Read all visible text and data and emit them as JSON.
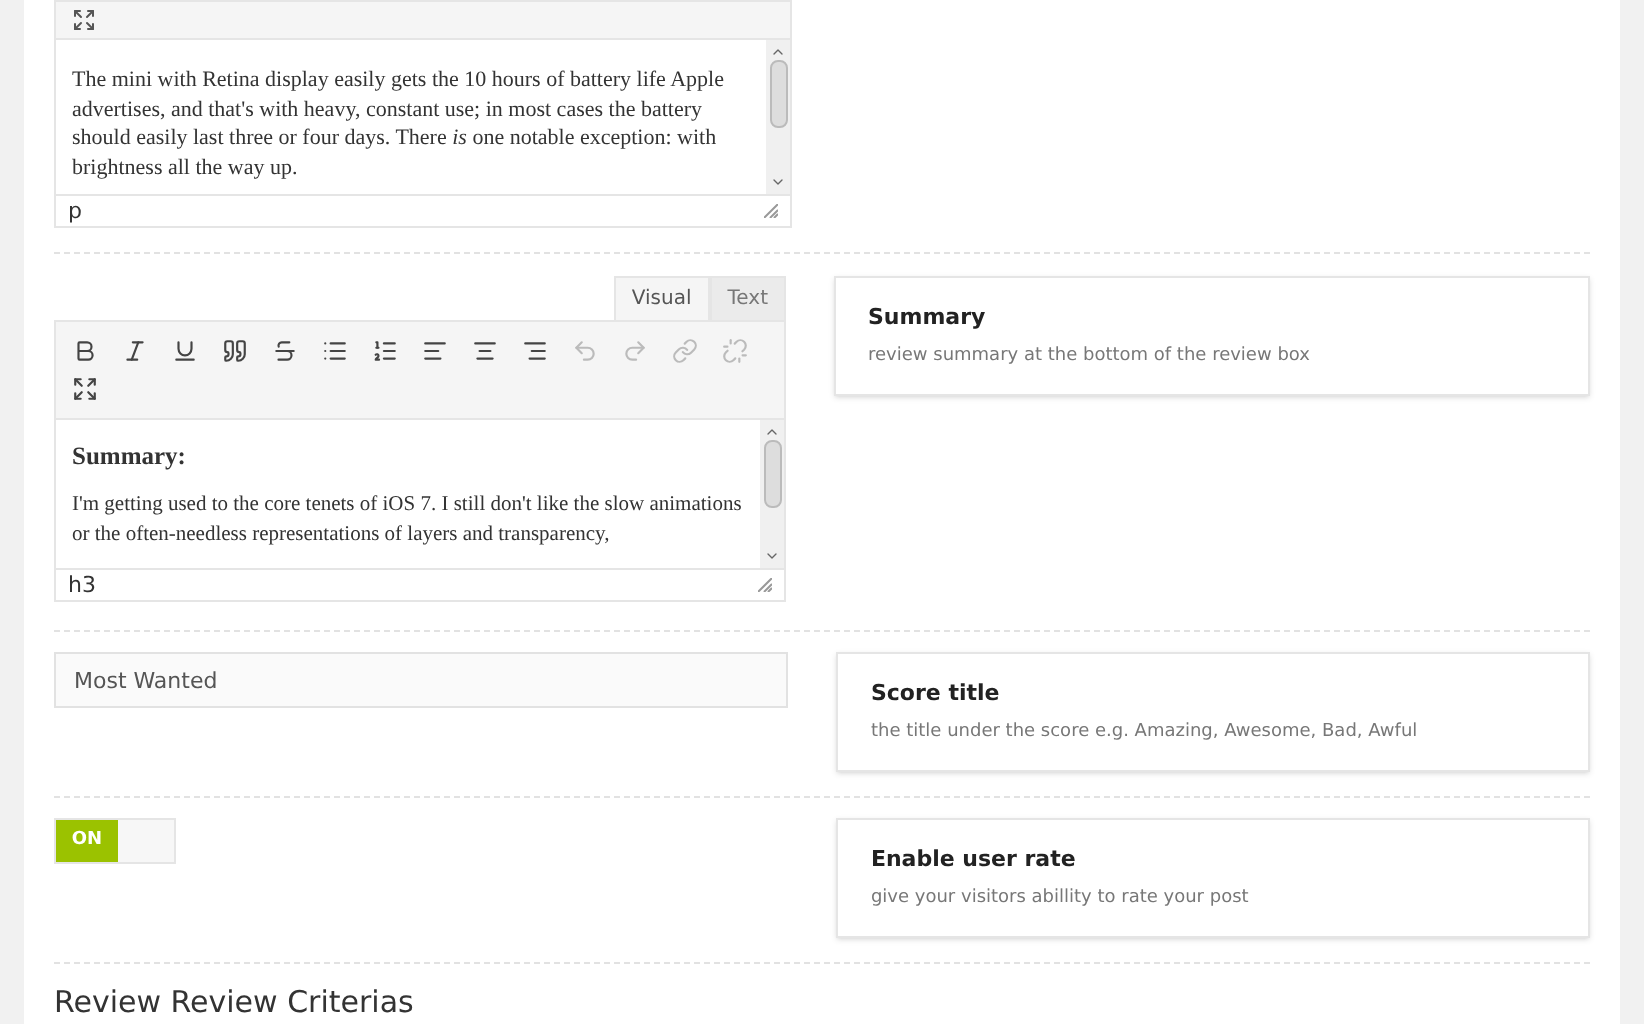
{
  "description_editor": {
    "content": "The mini with Retina display easily gets the 10 hours of battery life Apple advertises, and that's with heavy, constant use; in most cases the battery should easily last three or four days. There *is* one notable exception: with brightness all the way up.",
    "path": "p"
  },
  "summary_editor": {
    "tabs": [
      {
        "label": "Visual",
        "selected": true
      },
      {
        "label": "Text",
        "selected": false
      }
    ],
    "heading": "Summary:",
    "paragraph": "I'm getting used to the core tenets of iOS 7. I still don't like the slow animations or the often-needless representations of layers and transparency,",
    "path": "h3"
  },
  "summary_help": {
    "title": "Summary",
    "description": "review summary at the bottom of the review box"
  },
  "score_title": {
    "value": "Most Wanted"
  },
  "score_title_help": {
    "title": "Score title",
    "description": "the title under the score e.g. Amazing, Awesome, Bad, Awful"
  },
  "user_rate": {
    "on": true,
    "label": "ON"
  },
  "user_rate_help": {
    "title": "Enable user rate",
    "description": "give your visitors abillity to rate your post"
  },
  "criteria_heading": "Review Review Criterias"
}
